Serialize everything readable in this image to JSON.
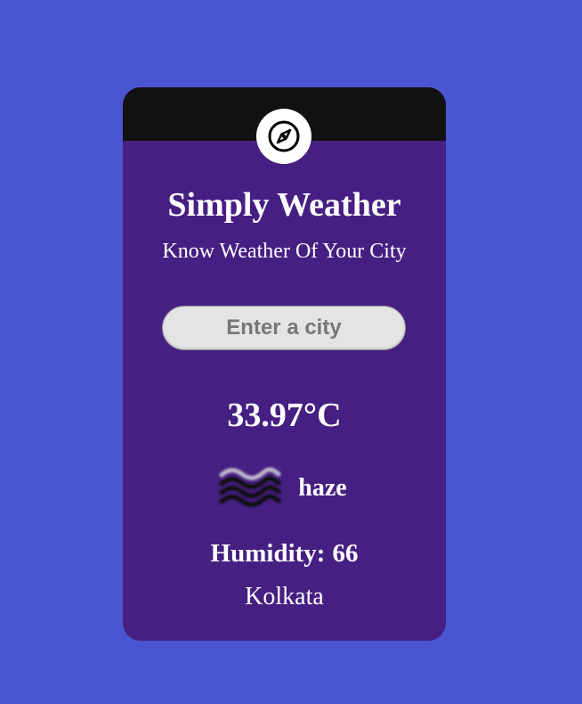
{
  "app": {
    "title": "Simply Weather",
    "subtitle": "Know Weather Of Your City"
  },
  "search": {
    "value": "",
    "placeholder": "Enter a city"
  },
  "weather": {
    "temperature": "33.97°C",
    "condition": "haze",
    "humidity_label": "Humidity:",
    "humidity_value": "66",
    "city": "Kolkata",
    "condition_icon": "haze-icon"
  },
  "header": {
    "badge_icon": "compass-icon"
  },
  "colors": {
    "page_background": "#4a55d2",
    "card_background": "#461f82",
    "card_header": "#111111",
    "text": "#ffffff",
    "input_background": "#e4e4e4"
  }
}
